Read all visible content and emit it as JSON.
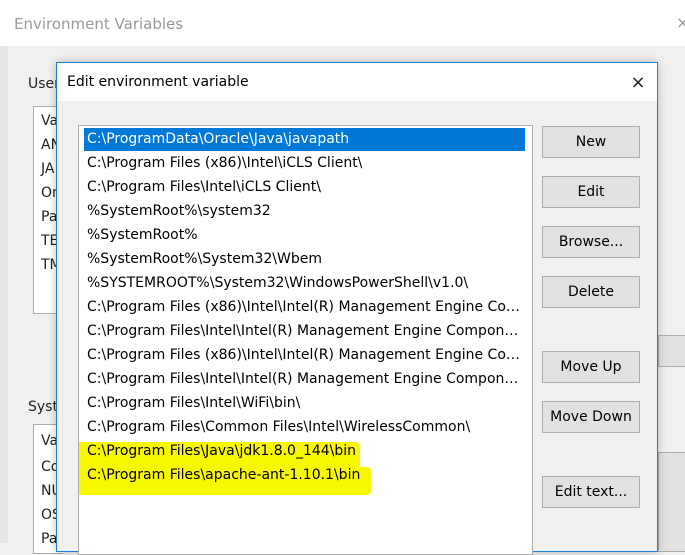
{
  "background_window": {
    "title": "Environment Variables",
    "close_glyph": "×",
    "user_section_label": "User",
    "user_items": [
      "Va",
      "AN",
      "JA",
      "On",
      "Pa",
      "TE",
      "TM"
    ],
    "system_section_label": "System",
    "system_items": [
      "Va",
      "Co",
      "NU",
      "OS",
      "Pa"
    ]
  },
  "dialog": {
    "title": "Edit environment variable",
    "close_glyph": "×"
  },
  "paths": [
    "C:\\ProgramData\\Oracle\\Java\\javapath",
    "C:\\Program Files (x86)\\Intel\\iCLS Client\\",
    "C:\\Program Files\\Intel\\iCLS Client\\",
    "%SystemRoot%\\system32",
    "%SystemRoot%",
    "%SystemRoot%\\System32\\Wbem",
    "%SYSTEMROOT%\\System32\\WindowsPowerShell\\v1.0\\",
    "C:\\Program Files (x86)\\Intel\\Intel(R) Management Engine Comp...",
    "C:\\Program Files\\Intel\\Intel(R) Management Engine Components...",
    "C:\\Program Files (x86)\\Intel\\Intel(R) Management Engine Comp...",
    "C:\\Program Files\\Intel\\Intel(R) Management Engine Components...",
    "C:\\Program Files\\Intel\\WiFi\\bin\\",
    "C:\\Program Files\\Common Files\\Intel\\WirelessCommon\\",
    "C:\\Program Files\\Java\\jdk1.8.0_144\\bin",
    "C:\\Program Files\\apache-ant-1.10.1\\bin"
  ],
  "buttons": {
    "new": "New",
    "edit": "Edit",
    "browse": "Browse...",
    "delete": "Delete",
    "move_up": "Move Up",
    "move_down": "Move Down",
    "edit_text": "Edit text..."
  },
  "colors": {
    "selection": "#0078d7",
    "highlighter": "#f7f700",
    "accent_border": "#1a7fd8"
  }
}
